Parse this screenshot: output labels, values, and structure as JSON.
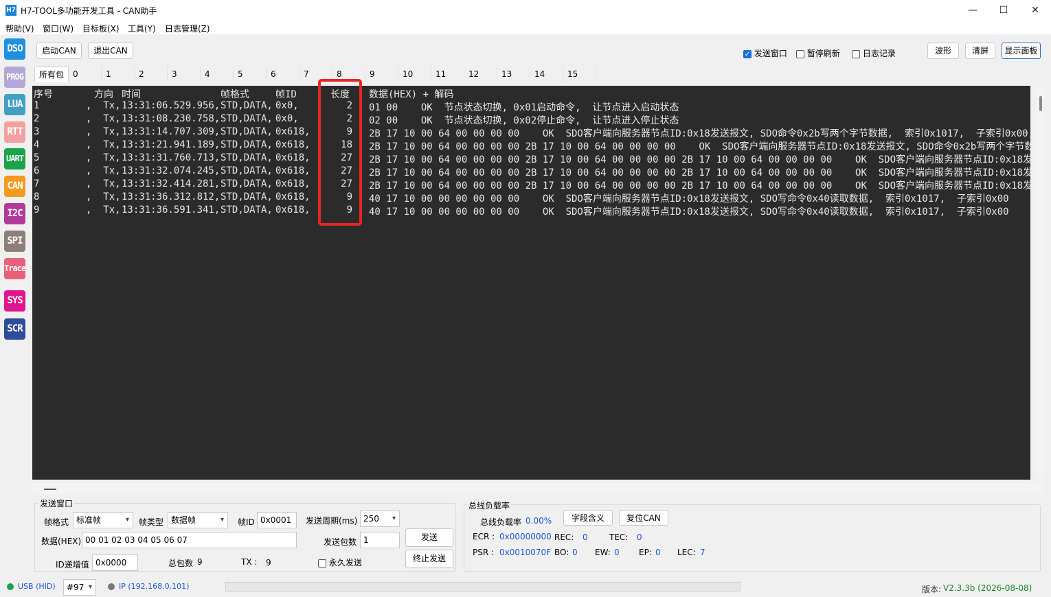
{
  "window": {
    "icon_text": "H7",
    "title": "H7-TOOL多功能开发工具 - CAN助手",
    "minimize": "—",
    "maximize": "☐",
    "close": "✕"
  },
  "menu": [
    "帮助(V)",
    "窗口(W)",
    "目标板(X)",
    "工具(Y)",
    "日志管理(Z)"
  ],
  "sidebar": [
    {
      "label": "DSO",
      "color": "#1e90e0"
    },
    {
      "label": "PROG",
      "color": "#b4a6d9"
    },
    {
      "label": "LUA",
      "color": "#3fa0c2"
    },
    {
      "label": "RTT",
      "color": "#f2a0a0"
    },
    {
      "label": "UART",
      "color": "#1aa34a"
    },
    {
      "label": "CAN",
      "color": "#f39b1c"
    },
    {
      "label": "I2C",
      "color": "#b0399a"
    },
    {
      "label": "SPI",
      "color": "#8e7e78"
    },
    {
      "label": "Trace",
      "color": "#e8607a"
    },
    {
      "label": "SYS",
      "color": "#e0148c"
    },
    {
      "label": "SCR",
      "color": "#2e4c9a"
    }
  ],
  "toolbar": {
    "start_can": "启动CAN",
    "exit_can": "退出CAN",
    "send_window": "发送窗口",
    "pause_refresh": "暂停刷新",
    "log_record": "日志记录",
    "waveform": "波形",
    "clear": "清屏",
    "show_panel": "显示面板",
    "send_window_checked": true,
    "pause_refresh_checked": false,
    "log_record_checked": false
  },
  "tabs": [
    "所有包",
    "0",
    "1",
    "2",
    "3",
    "4",
    "5",
    "6",
    "7",
    "8",
    "9",
    "10",
    "11",
    "12",
    "13",
    "14",
    "15"
  ],
  "console": {
    "headers": {
      "seq": "序号",
      "dir": "方向",
      "time": "时间",
      "fmt": "帧格式",
      "id": "帧ID",
      "len": "长度",
      "data": "数据(HEX) + 解码"
    },
    "rows": [
      {
        "seq": "1",
        "dir": ",  Tx,",
        "time": "13:31:06.529.956,",
        "fmt": "STD,DATA,",
        "id": "0x0,",
        "len": "2",
        "data": "01 00    OK  节点状态切换, 0x01启动命令,  让节点进入启动状态"
      },
      {
        "seq": "2",
        "dir": ",  Tx,",
        "time": "13:31:08.230.758,",
        "fmt": "STD,DATA,",
        "id": "0x0,",
        "len": "2",
        "data": "02 00    OK  节点状态切换, 0x02停止命令,  让节点进入停止状态"
      },
      {
        "seq": "3",
        "dir": ",  Tx,",
        "time": "13:31:14.707.309,",
        "fmt": "STD,DATA,",
        "id": "0x618,",
        "len": "9",
        "data": "2B 17 10 00 64 00 00 00 00    OK  SDO客户端向服务器节点ID:0x18发送报文, SDO命令0x2b写两个字节数据,  索引0x1017,  子索引0x00,"
      },
      {
        "seq": "4",
        "dir": ",  Tx,",
        "time": "13:31:21.941.189,",
        "fmt": "STD,DATA,",
        "id": "0x618,",
        "len": "18",
        "data": "2B 17 10 00 64 00 00 00 00 2B 17 10 00 64 00 00 00 00    OK  SDO客户端向服务器节点ID:0x18发送报文, SDO命令0x2b写两个字节数"
      },
      {
        "seq": "5",
        "dir": ",  Tx,",
        "time": "13:31:31.760.713,",
        "fmt": "STD,DATA,",
        "id": "0x618,",
        "len": "27",
        "data": "2B 17 10 00 64 00 00 00 00 2B 17 10 00 64 00 00 00 00 2B 17 10 00 64 00 00 00 00    OK  SDO客户端向服务器节点ID:0x18发送报"
      },
      {
        "seq": "6",
        "dir": ",  Tx,",
        "time": "13:31:32.074.245,",
        "fmt": "STD,DATA,",
        "id": "0x618,",
        "len": "27",
        "data": "2B 17 10 00 64 00 00 00 00 2B 17 10 00 64 00 00 00 00 2B 17 10 00 64 00 00 00 00    OK  SDO客户端向服务器节点ID:0x18发送报"
      },
      {
        "seq": "7",
        "dir": ",  Tx,",
        "time": "13:31:32.414.281,",
        "fmt": "STD,DATA,",
        "id": "0x618,",
        "len": "27",
        "data": "2B 17 10 00 64 00 00 00 00 2B 17 10 00 64 00 00 00 00 2B 17 10 00 64 00 00 00 00    OK  SDO客户端向服务器节点ID:0x18发送报"
      },
      {
        "seq": "8",
        "dir": ",  Tx,",
        "time": "13:31:36.312.812,",
        "fmt": "STD,DATA,",
        "id": "0x618,",
        "len": "9",
        "data": "40 17 10 00 00 00 00 00 00    OK  SDO客户端向服务器节点ID:0x18发送报文, SDO写命令0x40读取数据,  索引0x1017,  子索引0x00"
      },
      {
        "seq": "9",
        "dir": ",  Tx,",
        "time": "13:31:36.591.341,",
        "fmt": "STD,DATA,",
        "id": "0x618,",
        "len": "9",
        "data": "40 17 10 00 00 00 00 00 00    OK  SDO客户端向服务器节点ID:0x18发送报文, SDO写命令0x40读取数据,  索引0x1017,  子索引0x00"
      }
    ]
  },
  "send_panel": {
    "title": "发送窗口",
    "frame_format_label": "帧格式",
    "frame_format_value": "标准帧",
    "frame_type_label": "帧类型",
    "frame_type_value": "数据帧",
    "frame_id_label": "帧ID",
    "frame_id_value": "0x0001",
    "period_label": "发送周期(ms)",
    "period_value": "250",
    "data_label": "数据(HEX)",
    "data_value": "00 01 02 03 04 05 06 07",
    "count_label": "发送包数",
    "count_value": "1",
    "send_button": "发送",
    "stop_button": "终止发送",
    "id_inc_label": "ID递增值",
    "id_inc_value": "0x0000",
    "total_label": "总包数",
    "total_value": "9",
    "tx_label": "TX :",
    "tx_value": "9",
    "forever_label": "永久发送"
  },
  "bus_panel": {
    "title": "总线负载率",
    "load_label": "总线负载率",
    "load_value": "0.00%",
    "field_meaning": "字段含义",
    "reset_can": "复位CAN",
    "ecr_label": "ECR :",
    "ecr_value": "0x00000000",
    "rec_label": "REC:",
    "rec_value": "0",
    "tec_label": "TEC:",
    "tec_value": "0",
    "psr_label": "PSR :",
    "psr_value": "0x0010070F",
    "bo_label": "BO:",
    "bo_value": "0",
    "ew_label": "EW:",
    "ew_value": "0",
    "ep_label": "EP:",
    "ep_value": "0",
    "lec_label": "LEC:",
    "lec_value": "7"
  },
  "status": {
    "usb": "USB (HID)",
    "device": "#97",
    "ip": "IP (192.168.0.101)",
    "version_label": "版本:",
    "version_value": "V2.3.3b (2026-08-08)",
    "usb_color": "#1aa34a",
    "ip_color": "#777777"
  }
}
